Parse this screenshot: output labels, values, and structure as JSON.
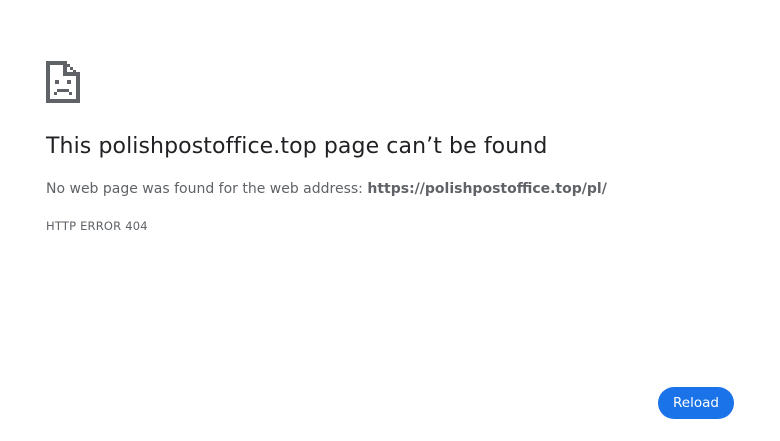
{
  "icon": "sad-document-icon",
  "error": {
    "headline_site": "This polishpostoffice.top",
    "headline_rest": " page can’t be found",
    "detail_prefix": "No web page was found for the web address: ",
    "url": "https://polishpostoffice.top/pl/",
    "code": "HTTP ERROR 404"
  },
  "actions": {
    "reload_label": "Reload"
  },
  "colors": {
    "text_primary": "#202124",
    "text_secondary": "#5f6368",
    "accent": "#1a73e8"
  }
}
